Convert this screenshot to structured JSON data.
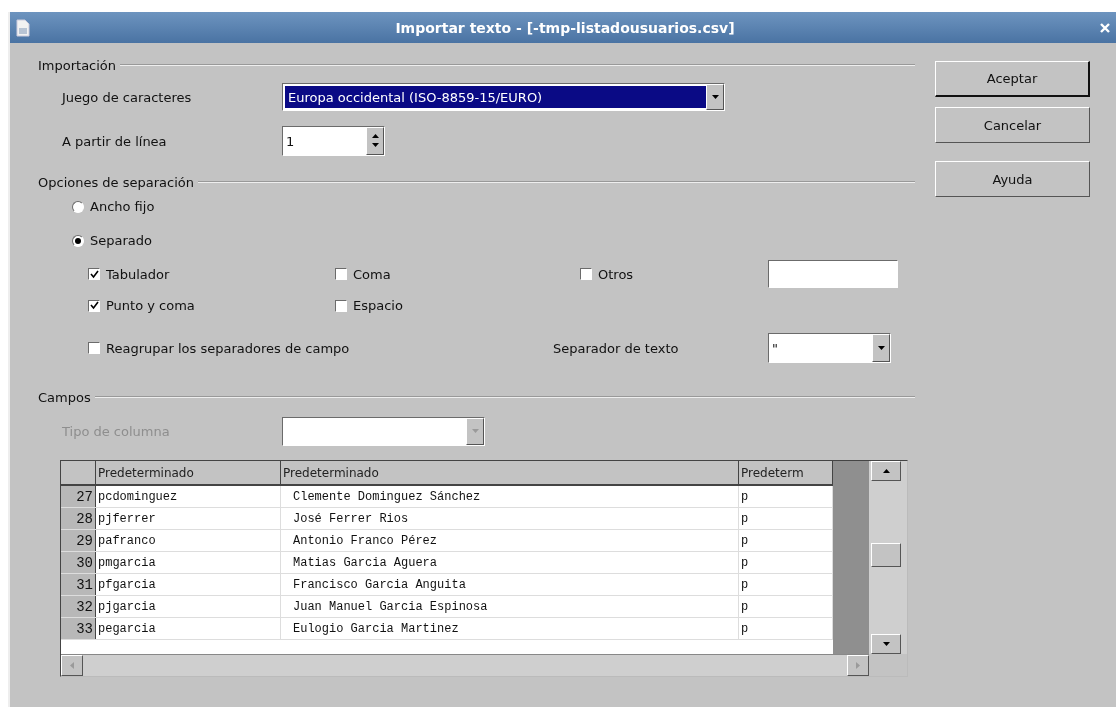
{
  "window": {
    "title": "Importar texto - [-tmp-listadousuarios.csv]"
  },
  "import_section": {
    "title": "Importación",
    "charset": {
      "label": "Juego de caracteres",
      "value": "Europa occidental (ISO-8859-15/EURO)"
    },
    "start_line": {
      "label": "A partir de línea",
      "value": "1"
    }
  },
  "separator_section": {
    "title": "Opciones de separación",
    "modes": [
      {
        "label": "Ancho fijo",
        "selected": false
      },
      {
        "label": "Separado",
        "selected": true
      }
    ],
    "separators": [
      {
        "label": "Tabulador",
        "checked": true
      },
      {
        "label": "Coma",
        "checked": false
      },
      {
        "label": "Otros",
        "checked": false
      },
      {
        "label": "Punto y coma",
        "checked": true
      },
      {
        "label": "Espacio",
        "checked": false
      }
    ],
    "merge_delimiters": {
      "label": "Reagrupar los separadores de campo",
      "checked": false
    },
    "text_delimiter": {
      "label": "Separador de texto",
      "value": "\""
    }
  },
  "fields_section": {
    "title": "Campos",
    "column_type": {
      "label": "Tipo de columna",
      "disabled": true
    }
  },
  "table": {
    "columns": [
      "Predeterminado",
      "Predeterminado",
      "Predeterm"
    ],
    "rows": [
      {
        "number": "27",
        "cells": [
          "pcdominguez",
          "Clemente Dominguez Sánchez",
          "p"
        ]
      },
      {
        "number": "28",
        "cells": [
          "pjferrer",
          "José Ferrer Rios",
          "p"
        ]
      },
      {
        "number": "29",
        "cells": [
          "pafranco",
          "Antonio Franco Pérez",
          "p"
        ]
      },
      {
        "number": "30",
        "cells": [
          "pmgarcia",
          "Matias Garcia Aguera",
          "p"
        ]
      },
      {
        "number": "31",
        "cells": [
          "pfgarcia",
          "Francisco Garcia Anguita",
          "p"
        ]
      },
      {
        "number": "32",
        "cells": [
          "pjgarcia",
          "Juan Manuel Garcia Espinosa",
          "p"
        ]
      },
      {
        "number": "33",
        "cells": [
          "pegarcia",
          "Eulogio Garcia Martinez",
          "p"
        ]
      }
    ]
  },
  "buttons": [
    "Aceptar",
    "Cancelar",
    "Ayuda"
  ]
}
